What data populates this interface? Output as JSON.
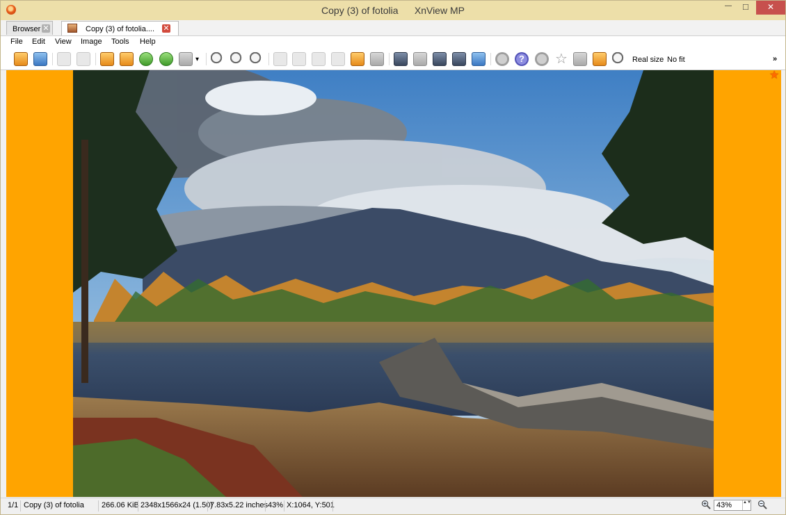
{
  "window": {
    "title": "Copy (3) of fotolia",
    "app_name": "XnView MP",
    "minimize_glyph": "—",
    "maximize_glyph": "□",
    "close_glyph": "✕"
  },
  "tabs": [
    {
      "label": "Browser",
      "close_glyph": "✕"
    },
    {
      "label": "Copy (3) of fotolia....",
      "close_glyph": "✕"
    }
  ],
  "menu": [
    "File",
    "Edit",
    "View",
    "Image",
    "Tools",
    "Help"
  ],
  "toolbar": {
    "real_size_label": "Real size",
    "no_fit_label": "No fit",
    "more_glyph": "»",
    "help_glyph": "?",
    "star_glyph": "☆",
    "dropdown_glyph": "▾"
  },
  "viewer": {
    "background_color": "#ffa400",
    "favorite_glyph": "★"
  },
  "status": {
    "index": "1/1",
    "filename": "Copy (3) of fotolia",
    "file_size": "266.06 KiB",
    "dimensions": "2348x1566x24 (1.50)",
    "print_size": "7.83x5.22 inches",
    "zoom_percent": "43%",
    "cursor": "X:1064, Y:501",
    "zoom_field_value": "43%",
    "spin_glyph": "▲▼"
  }
}
